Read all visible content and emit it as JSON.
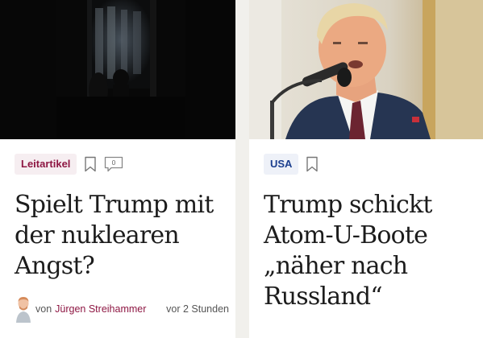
{
  "articles": [
    {
      "tag": "Leitartikel",
      "headline": "Spielt Trump mit der nuklearen Angst?",
      "author_prefix": "von",
      "author": "Jürgen Streihammer",
      "time": "vor 2 Stunden",
      "icons": [
        "bookmark-icon",
        "comment-icon"
      ]
    },
    {
      "tag": "USA",
      "headline": "Trump schickt Atom-U-Boote „näher nach Russland“",
      "icons": [
        "bookmark-icon"
      ]
    }
  ],
  "colors": {
    "background": "#f1f0ec",
    "tag_red_text": "#8e1743",
    "tag_red_bg": "#f6eef1",
    "tag_blue_text": "#1b3e8e",
    "tag_blue_bg": "#eef1f8",
    "headline": "#1c1c1c"
  }
}
